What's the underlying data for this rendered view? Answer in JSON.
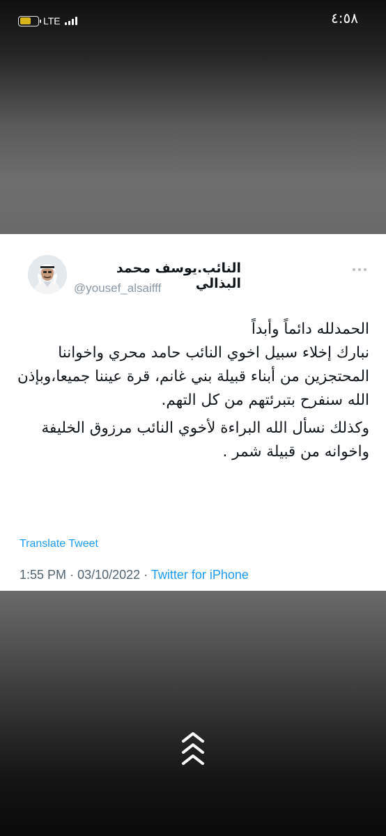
{
  "status_bar": {
    "network": "LTE",
    "time": "٤:٥٨"
  },
  "tweet": {
    "display_name": "النائب.يوسف محمد البذالي",
    "handle": "@yousef_alsaifff",
    "avatar_icon": "person-avatar-icon",
    "paragraphs": [
      "الحمدلله دائماً وأبداً\nنبارك إخلاء سبيل اخوي النائب حامد محري واخواننا المحتجزين من أبناء قبيلة بني غانم، قرة عيننا جميعا،وبإذن الله سنفرح بتبرئتهم من كل التهم.",
      "وكذلك نسأل الله البراءة لأخوي النائب مرزوق الخليفة واخوانه من قبيلة شمر ."
    ],
    "translate_label": "Translate Tweet",
    "time": "1:55 PM",
    "separator": "·",
    "date": "03/10/2022",
    "source": "Twitter for iPhone"
  },
  "colors": {
    "link": "#1d9bf0",
    "meta": "#536471",
    "handle": "#8b98a5",
    "battery": "#d9b51c"
  }
}
